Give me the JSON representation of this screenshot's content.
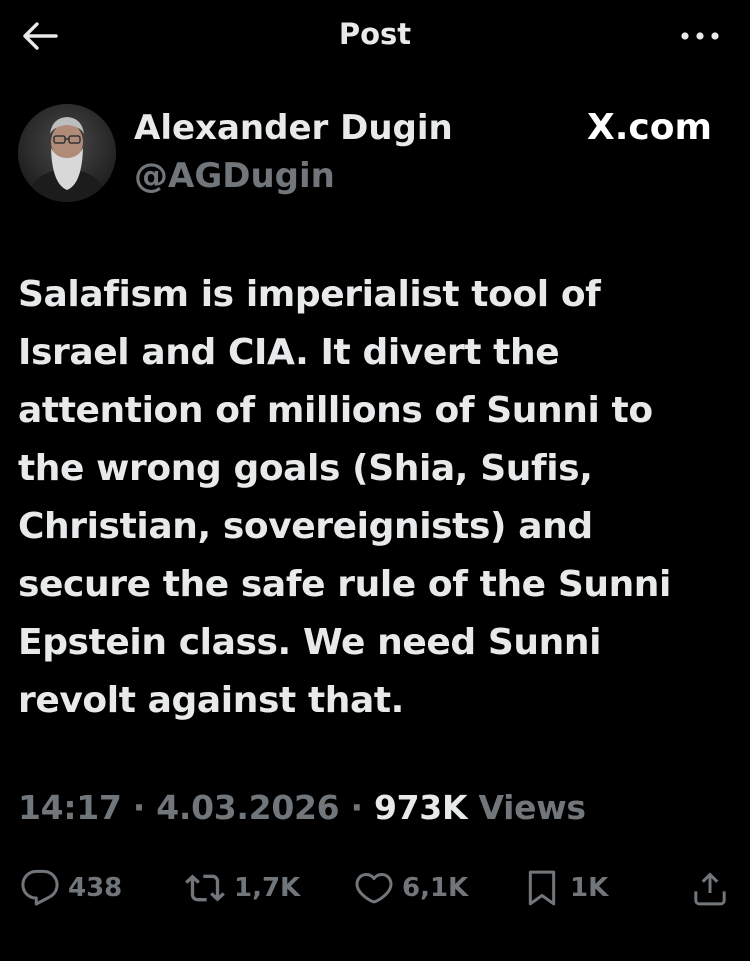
{
  "header": {
    "title": "Post",
    "back_icon": "arrow-left-icon",
    "more_icon": "more-horizontal-icon"
  },
  "author": {
    "name": "Alexander Dugin",
    "handle": "@AGDugin",
    "avatar_icon": "avatar-photo"
  },
  "watermark": {
    "text": "X.com"
  },
  "post": {
    "lines": [
      "Salafism is imperialist tool of",
      "Israel and CIA. It divert the",
      "attention of millions of Sunni to",
      "the wrong goals (Shia, Sufis,",
      "Christian, sovereignists) and",
      "secure the safe rule of the Sunni",
      "Epstein class. We need Sunni",
      "revolt against that."
    ]
  },
  "meta": {
    "time": "14:17",
    "separator": "·",
    "date": "4.03.2026",
    "views_count": "973K",
    "views_label": "Views"
  },
  "actions": {
    "reply": {
      "icon": "reply-icon",
      "count": "438"
    },
    "repost": {
      "icon": "repost-icon",
      "count": "1,7K"
    },
    "like": {
      "icon": "heart-icon",
      "count": "6,1K"
    },
    "bookmark": {
      "icon": "bookmark-icon",
      "count": "1K"
    },
    "share": {
      "icon": "share-icon"
    }
  },
  "colors": {
    "background": "#000000",
    "text_primary": "#e7e9ea",
    "text_secondary": "#71767b"
  }
}
